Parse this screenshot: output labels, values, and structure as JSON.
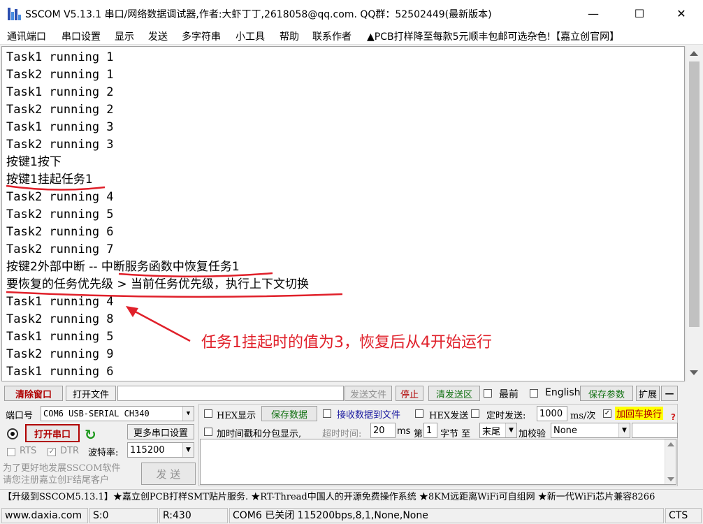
{
  "window": {
    "title": "SSCOM V5.13.1 串口/网络数据调试器,作者:大虾丁丁,2618058@qq.com. QQ群：52502449(最新版本)",
    "minimize": "—",
    "maximize": "☐",
    "close": "✕"
  },
  "menu": [
    "通讯端口",
    "串口设置",
    "显示",
    "发送",
    "多字符串",
    "小工具",
    "帮助",
    "联系作者",
    "▲PCB打样降至每款5元顺丰包邮可选杂色!【嘉立创官网】"
  ],
  "terminal": {
    "lines": [
      "Task1 running 1",
      "Task2 running 1",
      "Task1 running 2",
      "Task2 running 2",
      "Task1 running 3",
      "Task2 running 3",
      "按键1按下",
      "按键1挂起任务1",
      "Task2 running 4",
      "Task2 running 5",
      "Task2 running 6",
      "Task2 running 7",
      "按键2外部中断 -- 中断服务函数中恢复任务1",
      "要恢复的任务优先级 > 当前任务优先级，执行上下文切换",
      "Task1 running 4",
      "Task2 running 8",
      "Task1 running 5",
      "Task2 running 9",
      "Task1 running 6"
    ],
    "annotation": "任务1挂起时的值为3，恢复后从4开始运行"
  },
  "toolbar": {
    "clear": "清除窗口",
    "open_file": "打开文件",
    "send_file": "发送文件",
    "stop": "停止",
    "clear_send": "清发送区",
    "top_most": "最前",
    "english": "English",
    "save_params": "保存参数",
    "expand": "扩展",
    "collapse": "—"
  },
  "port": {
    "port_label": "端口号",
    "port_value": "COM6 USB-SERIAL CH340",
    "hex_display": "HEX显示",
    "save_data": "保存数据",
    "recv_to_file": "接收数据到文件",
    "hex_send": "HEX发送",
    "timed_send": "定时发送:",
    "interval": "1000",
    "interval_unit": "ms/次",
    "add_crlf": "加回车换行",
    "help_mark": "?",
    "open_port": "打开串口",
    "more_settings": "更多串口设置",
    "timestamp": "加时间戳和分包显示,",
    "timeout_label": "超时时间:",
    "timeout": "20",
    "timeout_unit": "ms",
    "byte_prefix": "第",
    "byte_index": "1",
    "byte_label": "字节 至",
    "byte_end": "末尾",
    "checksum_label": "加校验",
    "checksum": "None",
    "rts": "RTS",
    "dtr": "DTR",
    "baud_label": "波特率:",
    "baud": "115200",
    "promo": "为了更好地发展SSCOM软件\n请您注册嘉立创F结尾客户",
    "send": "发 送"
  },
  "marquee": "【升级到SSCOM5.13.1】★嘉立创PCB打样SMT贴片服务. ★RT-Thread中国人的开源免费操作系统 ★8KM远距离WiFi可自组网 ★新一代WiFi芯片兼容8266",
  "status": {
    "site": "www.daxia.com",
    "sent": "S:0",
    "received": "R:430",
    "port_state": "COM6 已关闭  115200bps,8,1,None,None",
    "cts": "CTS"
  },
  "colors": {
    "annotation": "#e0202a",
    "red_button_text": "#b00000",
    "green_button_text": "#107010",
    "crlf_highlight": "#ffff00"
  }
}
